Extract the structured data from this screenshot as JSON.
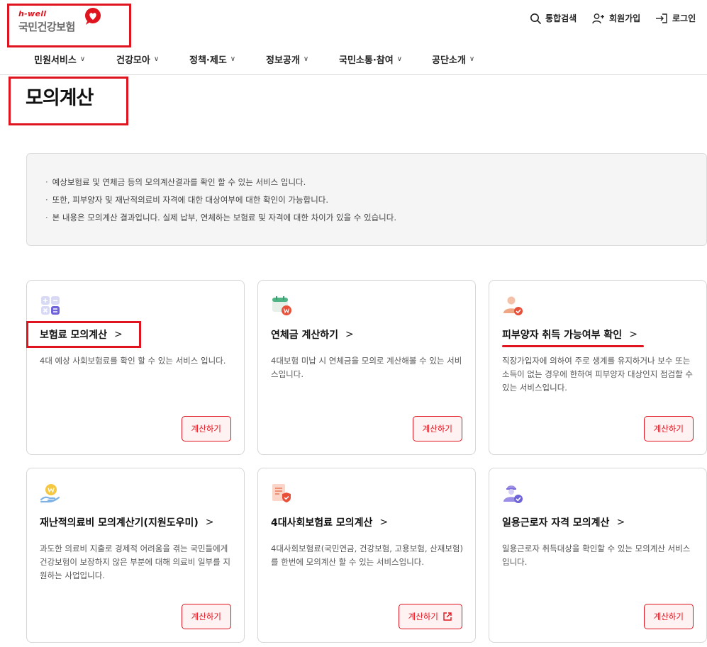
{
  "header": {
    "logo_hwell": "h-well",
    "logo_name": "국민건강보험",
    "util": {
      "search": "통합검색",
      "join": "회원가입",
      "login": "로그인"
    }
  },
  "gnb": {
    "items": [
      {
        "label": "민원서비스"
      },
      {
        "label": "건강모아"
      },
      {
        "label": "정책·제도"
      },
      {
        "label": "정보공개"
      },
      {
        "label": "국민소통·참여"
      },
      {
        "label": "공단소개"
      }
    ]
  },
  "page": {
    "title": "모의계산"
  },
  "notice": {
    "lines": [
      "예상보험료 및 연체금 등의 모의계산결과를 확인 할 수 있는 서비스 입니다.",
      "또한, 피부양자 및 재난적의료비 자격에 대한 대상여부에 대한 확인이 가능합니다.",
      "본 내용은 모의계산 결과입니다. 실제 납부, 연체하는 보험료 및 자격에 대한 차이가 있을 수 있습니다."
    ]
  },
  "cards": [
    {
      "title": "보험료 모의계산",
      "desc": "4대 예상 사회보험료를 확인 할 수 있는 서비스 입니다.",
      "button": "계산하기",
      "icon": "calculator-icon"
    },
    {
      "title": "연체금 계산하기",
      "desc": "4대보험 미납 시 연체금을 모의로 계산해볼 수 있는 서비스입니다.",
      "button": "계산하기",
      "icon": "calendar-won-icon"
    },
    {
      "title": "피부양자 취득 가능여부 확인",
      "desc": "직장가입자에 의하여 주로 생계를 유지하거나 보수 또는 소득이 없는 경우에 한하여 피부양자 대상인지 점검할 수 있는 서비스입니다.",
      "button": "계산하기",
      "icon": "person-check-icon"
    },
    {
      "title": "재난적의료비 모의계산기(지원도우미)",
      "desc": "과도한 의료비 지출로 경제적 어려움을 겪는 국민들에게 건강보험이 보장하지 않은 부분에 대해 의료비 일부를 지원하는 사업입니다.",
      "button": "계산하기",
      "icon": "hand-coin-icon"
    },
    {
      "title": "4대사회보험료 모의계산",
      "desc": "4대사회보험료(국민연금, 건강보험, 고용보험, 산재보험)를 한번에 모의계산 할 수 있는 서비스입니다.",
      "button": "계산하기",
      "icon": "document-shield-icon"
    },
    {
      "title": "일용근로자 자격 모의계산",
      "desc": "일용근로자 취득대상을 확인할 수 있는 모의계산 서비스입니다.",
      "button": "계산하기",
      "icon": "worker-check-icon"
    }
  ],
  "colors": {
    "accent": "#e0141e",
    "button_bg": "#fff2f2",
    "notice_bg": "#f5f5f5"
  }
}
